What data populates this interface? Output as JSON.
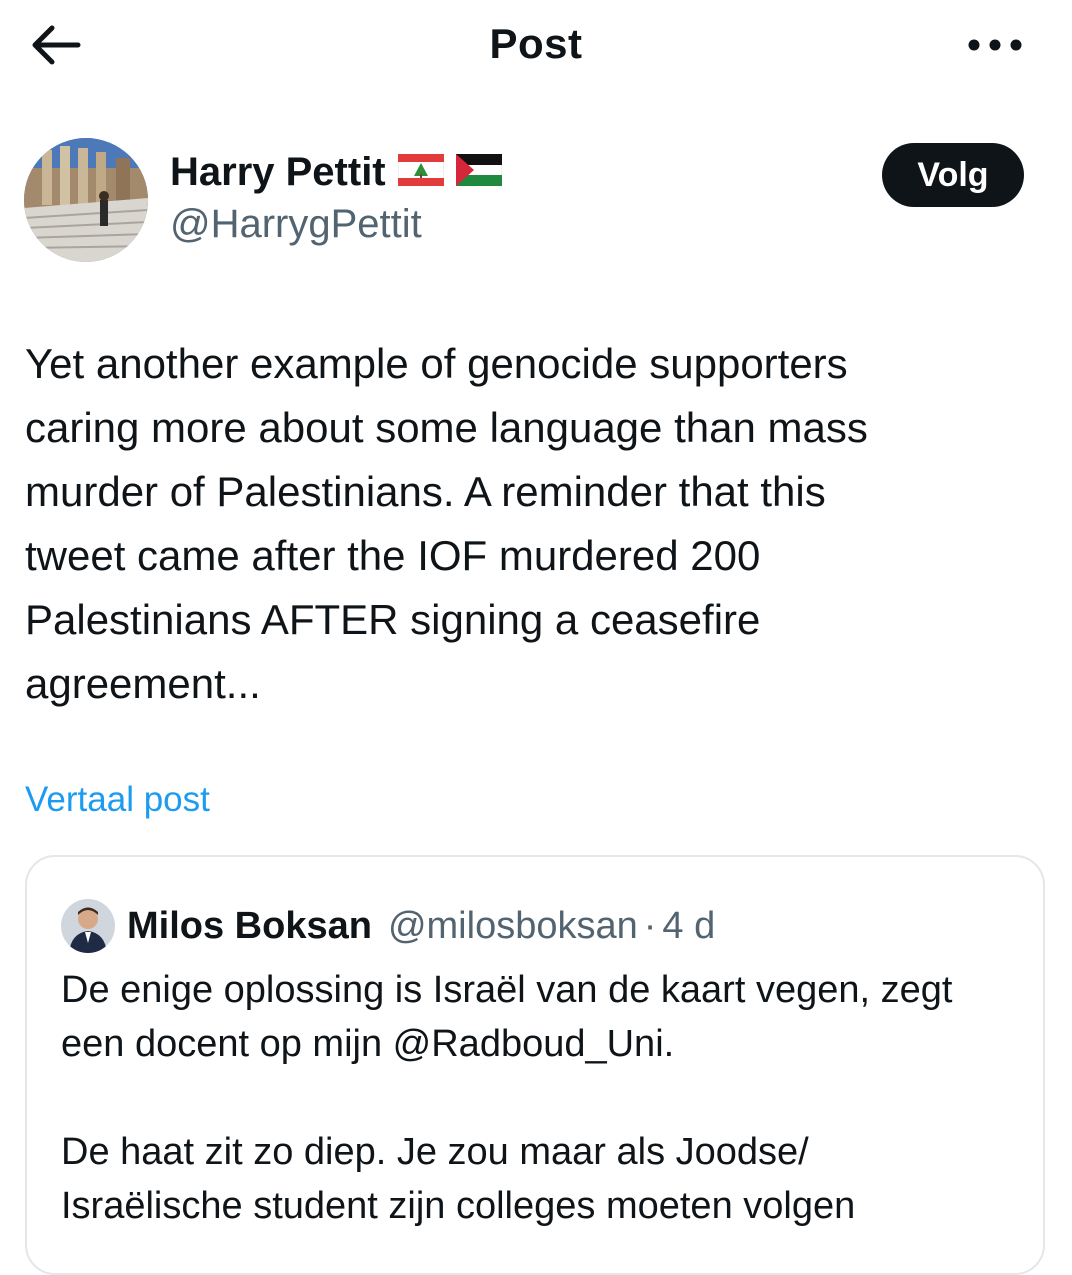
{
  "header": {
    "title": "Post",
    "back_icon": "arrow-left-icon",
    "more_icon": "more-horizontal-icon"
  },
  "author": {
    "display_name": "Harry Pettit",
    "handle": "@HarrygPettit",
    "flags": [
      "lebanon-flag-icon",
      "palestine-flag-icon"
    ],
    "follow_label": "Volg"
  },
  "tweet": {
    "lines": [
      "Yet another example of genocide supporters",
      "caring more about some language than mass",
      "murder of Palestinians. A reminder that this",
      "tweet came after the IOF murdered 200",
      "Palestinians AFTER signing a ceasefire",
      "agreement..."
    ],
    "translate_label": "Vertaal post"
  },
  "quote": {
    "display_name": "Milos Boksan",
    "handle": "@milosboksan",
    "separator": "·",
    "time": "4 d",
    "lines": [
      "De enige oplossing is Israël van de kaart vegen, zegt",
      "een docent op mijn @Radboud_Uni.",
      "",
      "De haat zit zo diep. Je zou maar als Joodse/",
      "Israëlische student zijn colleges moeten volgen"
    ]
  },
  "colors": {
    "link": "#1d9bf0",
    "text": "#0f1419",
    "secondary": "#536471",
    "border": "#e3e7ea",
    "follow_bg": "#0f1419"
  }
}
